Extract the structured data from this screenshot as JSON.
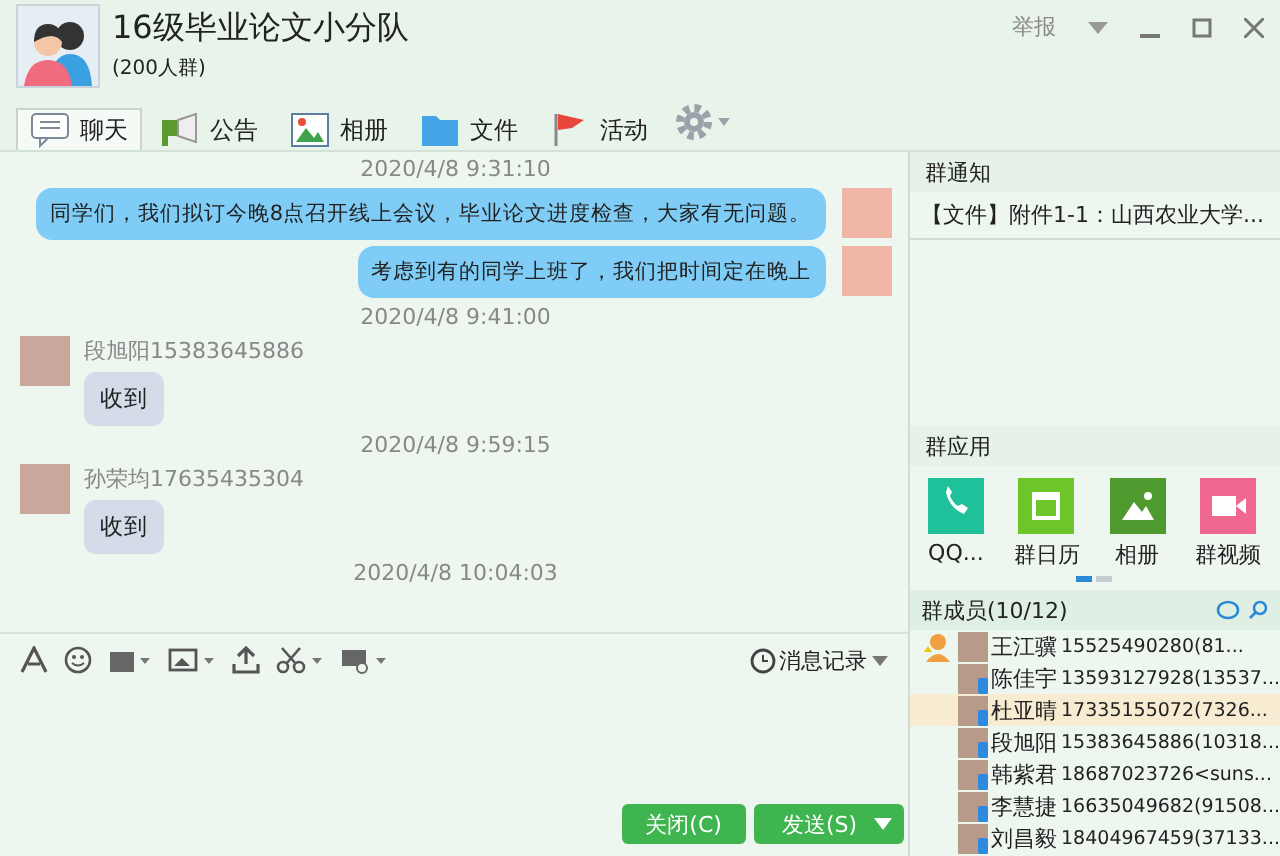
{
  "window": {
    "title": "16级毕业论文小分队",
    "subtitle": "(200人群)",
    "report": "举报"
  },
  "tabs": [
    {
      "label": "聊天",
      "kind": "chat",
      "selected": true
    },
    {
      "label": "公告",
      "kind": "notice",
      "selected": false
    },
    {
      "label": "相册",
      "kind": "album",
      "selected": false
    },
    {
      "label": "文件",
      "kind": "file",
      "selected": false
    },
    {
      "label": "活动",
      "kind": "event",
      "selected": false
    }
  ],
  "chat": {
    "messages": [
      {
        "kind": "time",
        "text": "2020/4/8 9:31:10"
      },
      {
        "kind": "outgoing",
        "text": "同学们，我们拟订今晚8点召开线上会议，毕业论文进度检查，大家有无问题。"
      },
      {
        "kind": "outgoing",
        "text": "考虑到有的同学上班了，我们把时间定在晚上"
      },
      {
        "kind": "time",
        "text": "2020/4/8 9:41:00"
      },
      {
        "kind": "incoming",
        "sender": "段旭阳15383645886",
        "text": "收到"
      },
      {
        "kind": "time",
        "text": "2020/4/8 9:59:15"
      },
      {
        "kind": "incoming",
        "sender": "孙荣均17635435304",
        "text": "收到"
      },
      {
        "kind": "time",
        "text": "2020/4/8 10:04:03"
      }
    ]
  },
  "composer": {
    "history": "消息记录",
    "buttons": [
      {
        "label": "关闭(C)",
        "kind": "close"
      },
      {
        "label": "发送(S)",
        "kind": "send"
      }
    ]
  },
  "sidebar": {
    "notice_title": "群通知",
    "notice": "【文件】附件1-1：山西农业大学...",
    "apps_title": "群应用",
    "apps": [
      {
        "label": "QQ...",
        "kind": "phone",
        "color": "#1fc19a"
      },
      {
        "label": "群日历",
        "kind": "calendar",
        "color": "#6cc62a"
      },
      {
        "label": "相册",
        "kind": "album",
        "color": "#4e9a2e"
      },
      {
        "label": "群视频",
        "kind": "video",
        "color": "#f06890"
      }
    ],
    "pages": [
      {
        "selected": true
      },
      {
        "selected": false
      }
    ],
    "members_title": "群成员(10/12)",
    "members": [
      {
        "name": "王江骥",
        "detail": "15525490280(81...",
        "kind": "owner",
        "selected": false
      },
      {
        "name": "陈佳宇",
        "detail": "13593127928(13537...",
        "kind": "mobile",
        "selected": false
      },
      {
        "name": "杜亚晴",
        "detail": "17335155072(7326...",
        "kind": "mobile",
        "selected": true
      },
      {
        "name": "段旭阳",
        "detail": "15383645886(10318...",
        "kind": "mobile",
        "selected": false
      },
      {
        "name": "韩紫君",
        "detail": "18687023726<suns...",
        "kind": "mobile",
        "selected": false
      },
      {
        "name": "李慧捷",
        "detail": "16635049682(91508...",
        "kind": "mobile",
        "selected": false
      },
      {
        "name": "刘昌毅",
        "detail": "18404967459(37133...",
        "kind": "mobile",
        "selected": false
      }
    ]
  }
}
